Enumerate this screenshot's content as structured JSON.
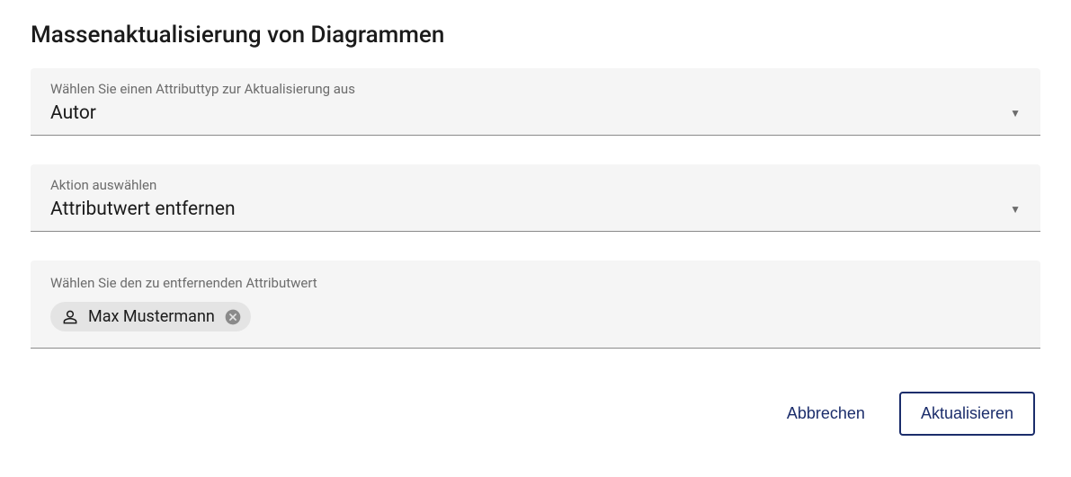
{
  "title": "Massenaktualisierung von Diagrammen",
  "fields": {
    "attributeType": {
      "label": "Wählen Sie einen Attributtyp zur Aktualisierung aus",
      "value": "Autor"
    },
    "action": {
      "label": "Aktion auswählen",
      "value": "Attributwert entfernen"
    },
    "attributeValue": {
      "label": "Wählen Sie den zu entfernenden Attributwert",
      "chip": "Max Mustermann"
    }
  },
  "buttons": {
    "cancel": "Abbrechen",
    "update": "Aktualisieren"
  }
}
